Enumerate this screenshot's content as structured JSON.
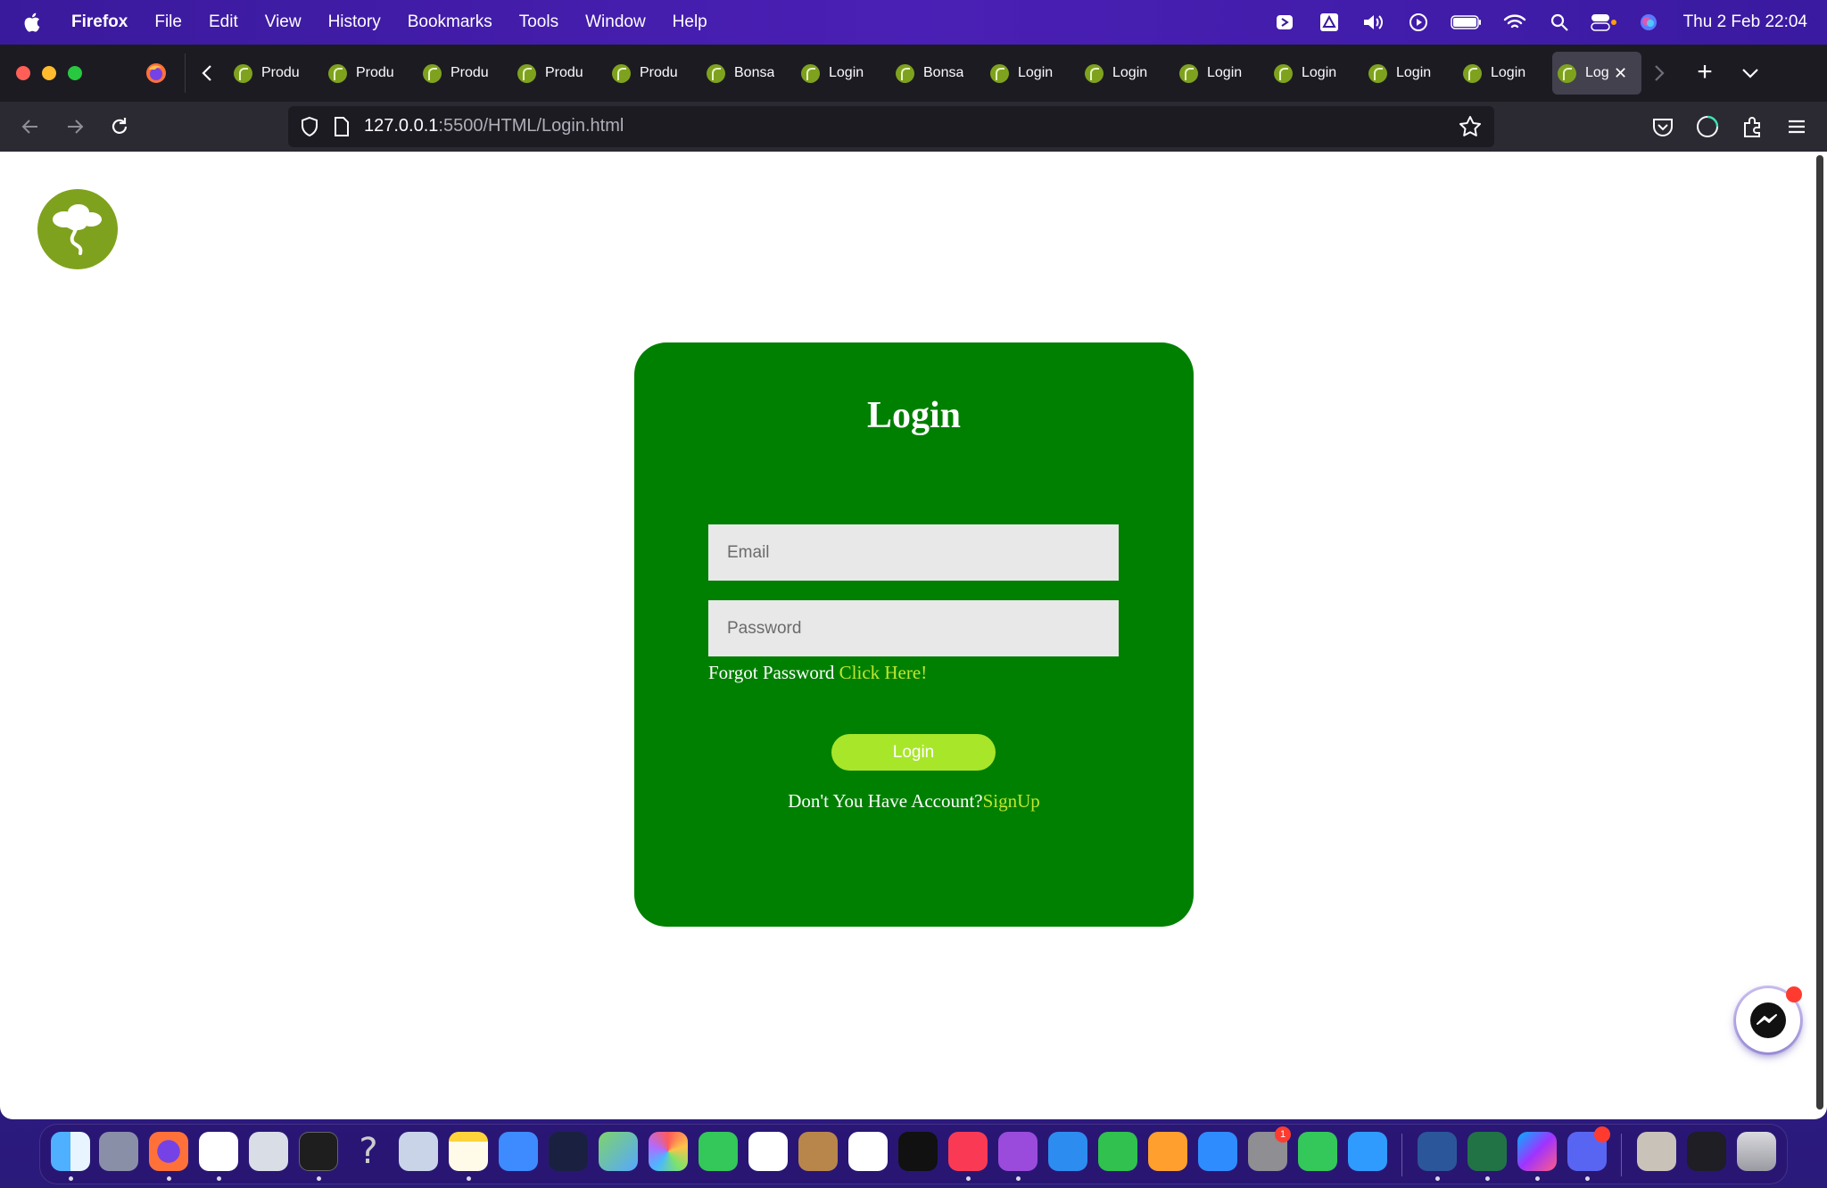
{
  "menubar": {
    "app_name": "Firefox",
    "items": [
      "File",
      "Edit",
      "View",
      "History",
      "Bookmarks",
      "Tools",
      "Window",
      "Help"
    ],
    "clock": "Thu 2 Feb  22:04",
    "status_icons": [
      "bluetooth-headphones-icon",
      "drive-icon",
      "volume-icon",
      "play-icon",
      "battery-icon",
      "wifi-icon",
      "search-icon",
      "control-center-icon",
      "siri-icon"
    ]
  },
  "browser": {
    "tabs": [
      {
        "label": "Produ"
      },
      {
        "label": "Produ"
      },
      {
        "label": "Produ"
      },
      {
        "label": "Produ"
      },
      {
        "label": "Produ"
      },
      {
        "label": "Bonsa"
      },
      {
        "label": "Login"
      },
      {
        "label": "Bonsa"
      },
      {
        "label": "Login"
      },
      {
        "label": "Login"
      },
      {
        "label": "Login"
      },
      {
        "label": "Login"
      },
      {
        "label": "Login"
      },
      {
        "label": "Login"
      }
    ],
    "active_tab": {
      "label": "Log"
    },
    "url": {
      "host": "127.0.0.1",
      "rest": ":5500/HTML/Login.html"
    }
  },
  "login": {
    "title": "Login",
    "email_placeholder": "Email",
    "password_placeholder": "Password",
    "forgot_text": "Forgot Password ",
    "forgot_link": "Click Here!",
    "button_label": "Login",
    "signup_text": "Don't You Have Account?",
    "signup_link": "SignUp"
  },
  "colors": {
    "card_bg": "#008000",
    "link": "#c0e632",
    "button": "#a8e62a",
    "logo": "#7fa21e"
  },
  "dock": {
    "badges": {
      "settings": "1"
    },
    "apps": [
      "finder",
      "launchpad",
      "firefox",
      "vscode",
      "vpn",
      "terminal",
      "help",
      "settings-utility",
      "notes",
      "mail",
      "netflix",
      "maps",
      "photos",
      "facetime",
      "calendar",
      "contacts",
      "reminders",
      "apple-tv",
      "music",
      "podcasts",
      "keynote",
      "numbers",
      "pages",
      "app-store",
      "system-settings",
      "messages",
      "safari",
      "word",
      "excel",
      "messenger",
      "discord",
      "profile-photo",
      "screenshot",
      "trash"
    ]
  }
}
